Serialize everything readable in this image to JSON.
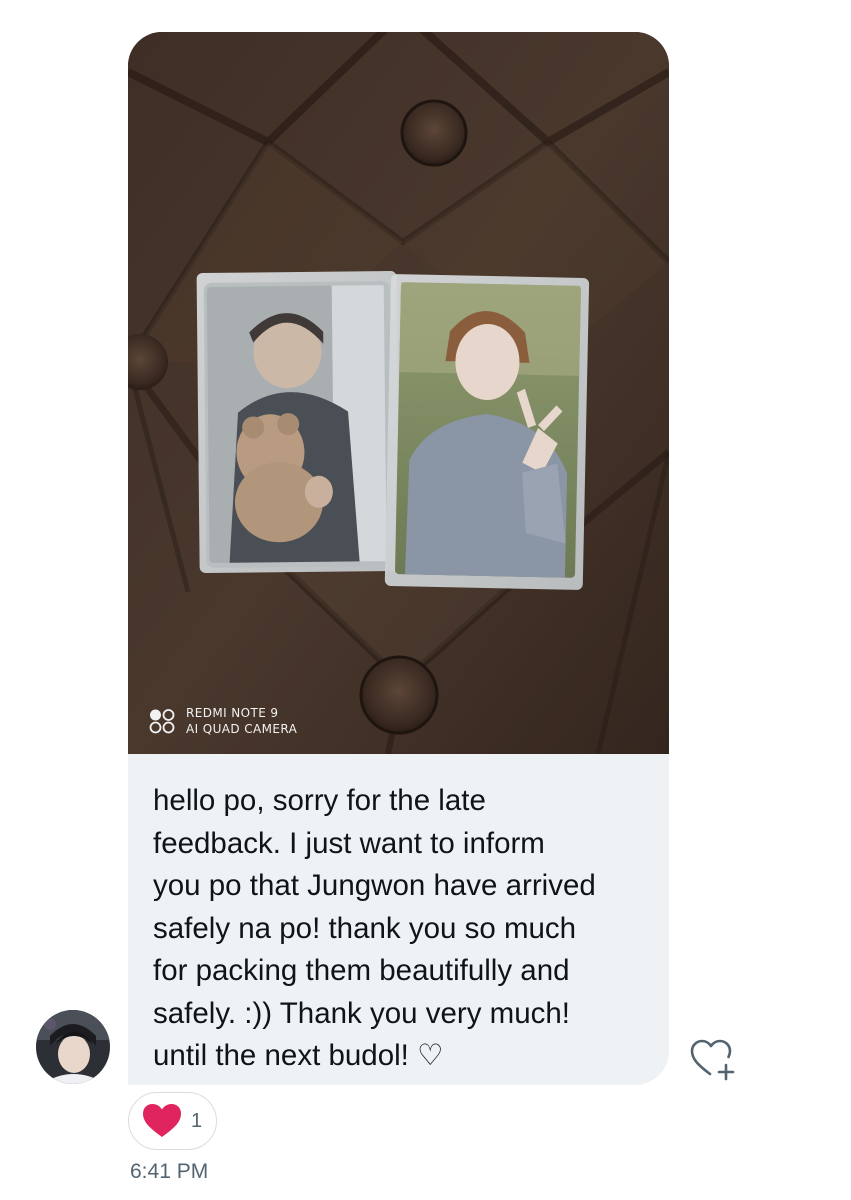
{
  "message": {
    "camera_watermark": {
      "line1": "REDMI NOTE 9",
      "line2": "AI QUAD CAMERA"
    },
    "text": "hello po, sorry for the late\nfeedback. I just want to inform\nyou po that Jungwon have arrived\nsafely na po! thank you so much\nfor packing them beautifully and\nsafely. :)) Thank you very much!\nuntil the next budol! ♡",
    "reaction": {
      "icon": "heart-icon",
      "count": "1",
      "color": "#e0245e"
    },
    "timestamp": "6:41 PM",
    "add_reaction_icon": "heart-plus-icon"
  },
  "colors": {
    "bubble_background": "#eef2f4",
    "text": "#0f1419",
    "meta_text": "#536471"
  }
}
